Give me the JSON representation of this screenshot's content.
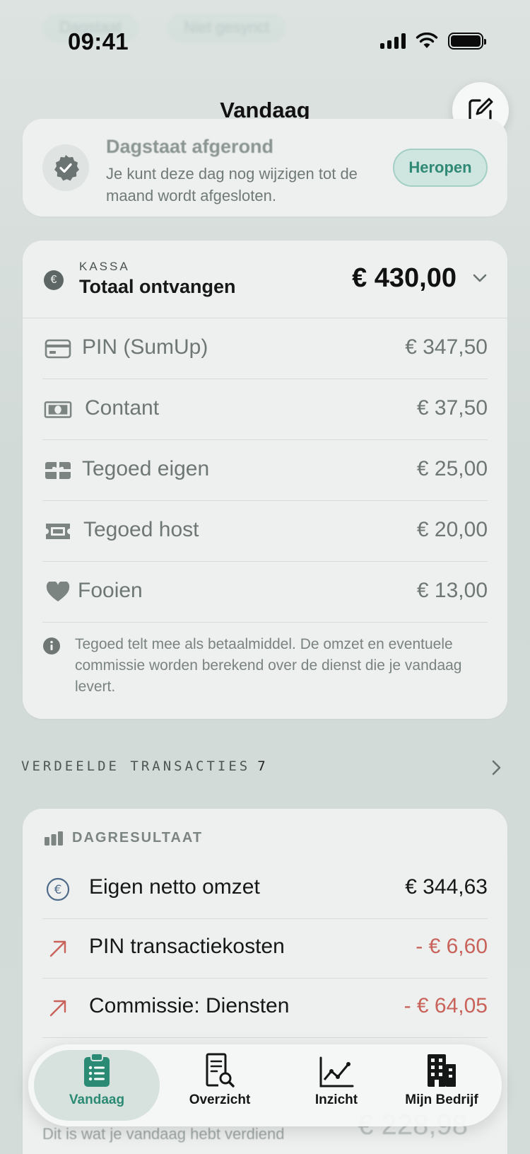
{
  "status_bar": {
    "time": "09:41",
    "ghost_tabs": [
      "Dagstaat",
      "Niet gesynct"
    ]
  },
  "nav": {
    "title": "Vandaag"
  },
  "closed_banner": {
    "title": "Dagstaat afgerond",
    "subtitle": "Je kunt deze dag nog wijzigen tot de maand wordt afgesloten.",
    "action_label": "Heropen"
  },
  "kassa": {
    "label": "KASSA",
    "title": "Totaal ontvangen",
    "total": "€ 430,00",
    "rows": [
      {
        "label": "PIN (SumUp)",
        "amount": "€ 347,50",
        "icon": "card-icon"
      },
      {
        "label": "Contant",
        "amount": "€ 37,50",
        "icon": "cash-icon"
      },
      {
        "label": "Tegoed eigen",
        "amount": "€ 25,00",
        "icon": "gift-icon"
      },
      {
        "label": "Tegoed host",
        "amount": "€ 20,00",
        "icon": "ticket-icon"
      },
      {
        "label": "Fooien",
        "amount": "€ 13,00",
        "icon": "heart-icon"
      }
    ],
    "note": "Tegoed telt mee als betaalmiddel. De omzet en eventuele commissie worden berekend over de dienst die je vandaag levert."
  },
  "split_transactions": {
    "label": "VERDEELDE TRANSACTIES",
    "count": "7"
  },
  "day_result": {
    "label": "DAGRESULTAAT",
    "rows": [
      {
        "label": "Eigen netto omzet",
        "amount": "€ 344,63",
        "negative": false
      },
      {
        "label": "PIN transactiekosten",
        "amount": "- € 6,60",
        "negative": true
      },
      {
        "label": "Commissie: Diensten",
        "amount": "- € 64,05",
        "negative": true
      }
    ],
    "footer_text": "Dit is wat je vandaag hebt verdiend",
    "footer_amount": "€ 228,98"
  },
  "tab_bar": {
    "tabs": [
      {
        "label": "Vandaag",
        "active": true
      },
      {
        "label": "Overzicht",
        "active": false
      },
      {
        "label": "Inzicht",
        "active": false
      },
      {
        "label": "Mijn Bedrijf",
        "active": false
      }
    ]
  },
  "colors": {
    "accent": "#2a8a74",
    "negative": "#c9625a",
    "background": "#d4dcda",
    "card": "#edf0ef"
  }
}
